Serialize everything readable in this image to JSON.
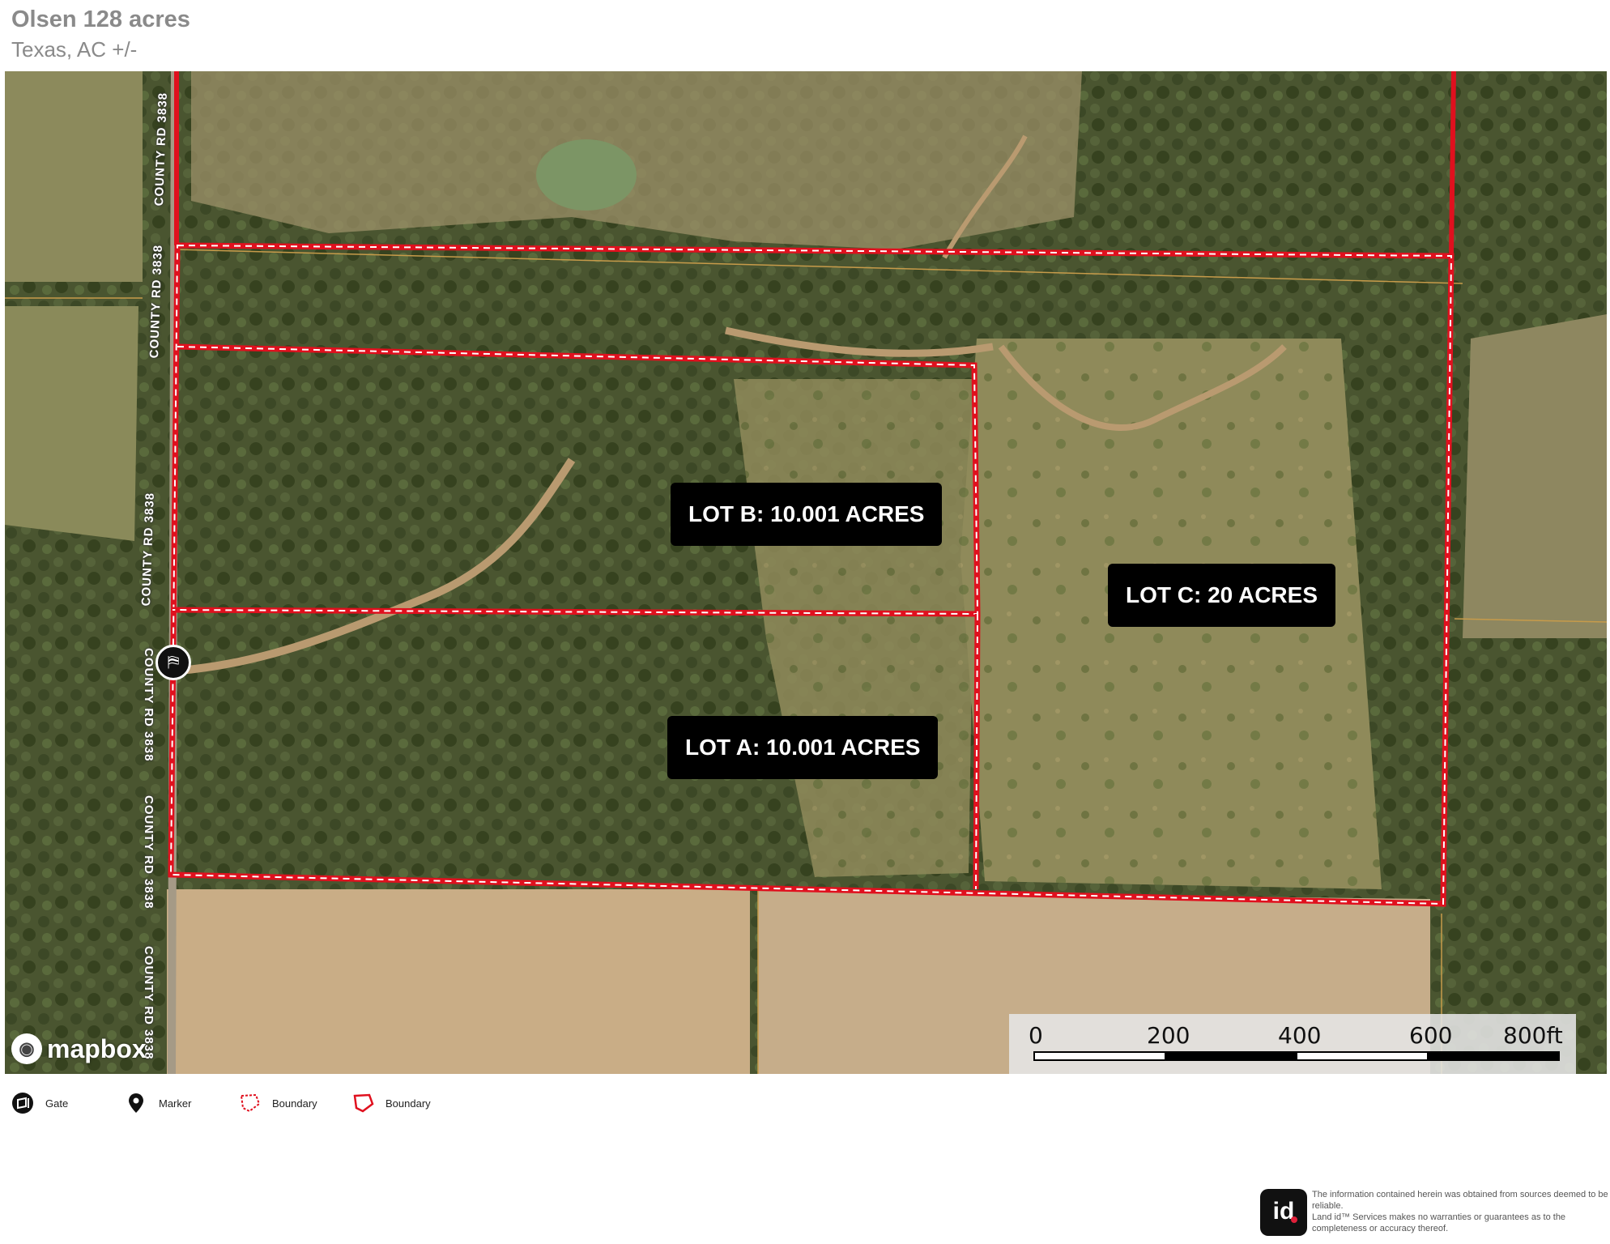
{
  "header": {
    "title": "Olsen 128 acres",
    "subtitle": "Texas,  AC +/-"
  },
  "map": {
    "lots": [
      {
        "label": "LOT B: 10.001 ACRES"
      },
      {
        "label": "LOT C: 20 ACRES"
      },
      {
        "label": "LOT A: 10.001 ACRES"
      }
    ],
    "road_labels": [
      "COUNTY RD 3838",
      "COUNTY RD 3838",
      "COUNTY RD 3838",
      "COUNTY RD 3838",
      "COUNTY RD 3838",
      "COUNTY RD 3838"
    ],
    "gate_icon": "gate-icon",
    "attribution": "mapbox",
    "boundary_color": "#e0101e"
  },
  "scale_bar": {
    "ticks": [
      "0",
      "200",
      "400",
      "600",
      "800ft"
    ]
  },
  "legend": {
    "items": [
      {
        "icon": "gate-icon",
        "label": "Gate"
      },
      {
        "icon": "marker-icon",
        "label": "Marker"
      },
      {
        "icon": "boundary-dashed-icon",
        "label": "Boundary"
      },
      {
        "icon": "boundary-solid-icon",
        "label": "Boundary"
      }
    ]
  },
  "footer": {
    "logo_text": "id",
    "disclaimer": "The information contained herein was obtained from sources deemed to be reliable.\n Land id™ Services makes no warranties or guarantees as to the completeness or accuracy thereof."
  }
}
